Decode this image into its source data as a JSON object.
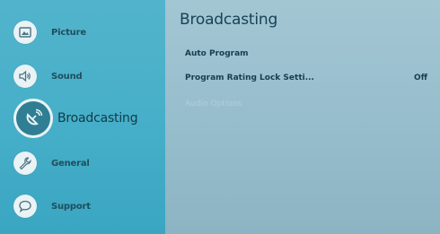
{
  "sidebar": {
    "items": [
      {
        "label": "Picture",
        "icon": "picture-icon"
      },
      {
        "label": "Sound",
        "icon": "speaker-icon"
      },
      {
        "label": "Broadcasting",
        "icon": "satellite-dish-icon",
        "active": true
      },
      {
        "label": "General",
        "icon": "wrench-icon"
      },
      {
        "label": "Support",
        "icon": "chat-bubble-icon"
      }
    ]
  },
  "main": {
    "title": "Broadcasting",
    "rows": [
      {
        "label": "Auto Program",
        "value": ""
      },
      {
        "label": "Program Rating Lock Setti...",
        "value": "Off"
      },
      {
        "label": "Audio Options",
        "value": "",
        "disabled": true
      }
    ]
  }
}
